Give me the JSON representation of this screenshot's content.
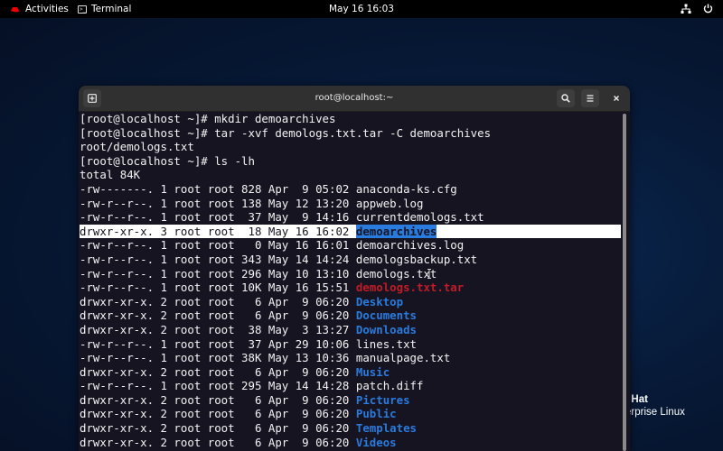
{
  "topbar": {
    "activities_label": "Activities",
    "app_label": "Terminal",
    "clock": "May 16  16:03",
    "icons": [
      "redhat-hat-icon",
      "terminal-icon",
      "network-icon",
      "power-icon"
    ]
  },
  "window": {
    "title": "root@localhost:~",
    "buttons": [
      "new-tab",
      "search",
      "menu",
      "close"
    ]
  },
  "desktop": {
    "brand_line1": "l Hat",
    "brand_line2": "erprise Linux"
  },
  "colors": {
    "terminal_bg": "#171421",
    "directory": "#2a7bde",
    "archive": "#c01c28",
    "headerbar": "#303030"
  },
  "terminal": {
    "lines": [
      {
        "prefix": "[root@localhost ~]# mkdir demoarchives",
        "name": "",
        "kind": "plain"
      },
      {
        "prefix": "[root@localhost ~]# tar -xvf demologs.txt.tar -C demoarchives",
        "name": "",
        "kind": "plain"
      },
      {
        "prefix": "root/demologs.txt",
        "name": "",
        "kind": "plain"
      },
      {
        "prefix": "[root@localhost ~]# ls -lh",
        "name": "",
        "kind": "plain"
      },
      {
        "prefix": "total 84K",
        "name": "",
        "kind": "plain"
      },
      {
        "prefix": "-rw-------. 1 root root 828 Apr  9 05:02 ",
        "name": "anaconda-ks.cfg",
        "kind": "file"
      },
      {
        "prefix": "-rw-r--r--. 1 root root 138 May 12 13:20 ",
        "name": "appweb.log",
        "kind": "file"
      },
      {
        "prefix": "-rw-r--r--. 1 root root  37 May  9 14:16 ",
        "name": "currentdemologs.txt",
        "kind": "file"
      },
      {
        "prefix": "drwxr-xr-x. 3 root root  18 May 16 16:02 ",
        "name": "demoarchives",
        "kind": "dir",
        "selected": true
      },
      {
        "prefix": "-rw-r--r--. 1 root root   0 May 16 16:01 ",
        "name": "demoarchives.log",
        "kind": "file"
      },
      {
        "prefix": "-rw-r--r--. 1 root root 343 May 14 14:24 ",
        "name": "demologsbackup.txt",
        "kind": "file"
      },
      {
        "prefix": "-rw-r--r--. 1 root root 296 May 10 13:10 ",
        "name": "demologs.txt",
        "kind": "file"
      },
      {
        "prefix": "-rw-r--r--. 1 root root 10K May 16 15:51 ",
        "name": "demologs.txt.tar",
        "kind": "archive"
      },
      {
        "prefix": "drwxr-xr-x. 2 root root   6 Apr  9 06:20 ",
        "name": "Desktop",
        "kind": "dir"
      },
      {
        "prefix": "drwxr-xr-x. 2 root root   6 Apr  9 06:20 ",
        "name": "Documents",
        "kind": "dir"
      },
      {
        "prefix": "drwxr-xr-x. 2 root root  38 May  3 13:27 ",
        "name": "Downloads",
        "kind": "dir"
      },
      {
        "prefix": "-rw-r--r--. 1 root root  37 Apr 29 10:06 ",
        "name": "lines.txt",
        "kind": "file"
      },
      {
        "prefix": "-rw-r--r--. 1 root root 38K May 13 10:36 ",
        "name": "manualpage.txt",
        "kind": "file"
      },
      {
        "prefix": "drwxr-xr-x. 2 root root   6 Apr  9 06:20 ",
        "name": "Music",
        "kind": "dir"
      },
      {
        "prefix": "-rw-r--r--. 1 root root 295 May 14 14:28 ",
        "name": "patch.diff",
        "kind": "file"
      },
      {
        "prefix": "drwxr-xr-x. 2 root root   6 Apr  9 06:20 ",
        "name": "Pictures",
        "kind": "dir"
      },
      {
        "prefix": "drwxr-xr-x. 2 root root   6 Apr  9 06:20 ",
        "name": "Public",
        "kind": "dir"
      },
      {
        "prefix": "drwxr-xr-x. 2 root root   6 Apr  9 06:20 ",
        "name": "Templates",
        "kind": "dir"
      },
      {
        "prefix": "drwxr-xr-x. 2 root root   6 Apr  9 06:20 ",
        "name": "Videos",
        "kind": "dir"
      }
    ]
  }
}
